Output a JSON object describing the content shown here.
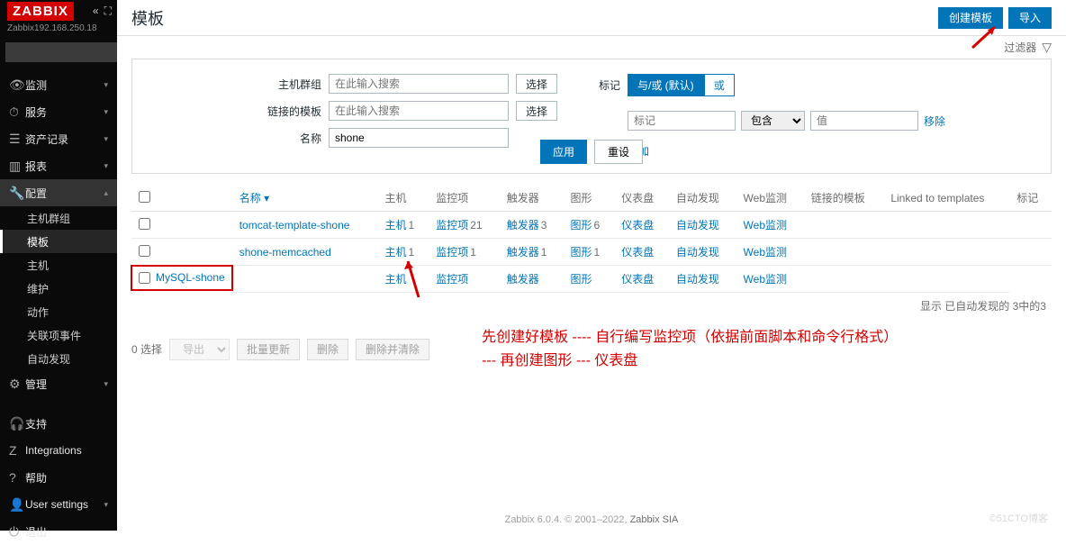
{
  "brand": "ZABBIX",
  "server": "Zabbix192.168.250.18",
  "nav": {
    "monitor": "监测",
    "service": "服务",
    "asset": "资产记录",
    "report": "报表",
    "config": "配置",
    "admin": "管理",
    "support": "支持",
    "integrations": "Integrations",
    "help": "帮助",
    "usersettings": "User settings",
    "logout": "退出"
  },
  "config_sub": {
    "hostgroups": "主机群组",
    "templates": "模板",
    "hosts": "主机",
    "maintenance": "维护",
    "actions": "动作",
    "eventcorrelation": "关联项事件",
    "discovery": "自动发现"
  },
  "page": {
    "title": "模板",
    "create": "创建模板",
    "import": "导入",
    "filterlabel": "过滤器"
  },
  "filter": {
    "hostgroups_label": "主机群组",
    "hostgroups_ph": "在此输入搜索",
    "select_btn": "选择",
    "linked_label": "链接的模板",
    "linked_ph": "在此输入搜索",
    "name_label": "名称",
    "name_val": "shone",
    "tag_label": "标记",
    "and_or": "与/或 (默认)",
    "or": "或",
    "tag_ph": "标记",
    "contains": "包含",
    "value_ph": "值",
    "remove": "移除",
    "add": "添加",
    "apply": "应用",
    "reset": "重设"
  },
  "table": {
    "headers": {
      "name": "名称",
      "hosts": "主机",
      "items": "监控项",
      "triggers": "触发器",
      "graphs": "图形",
      "dashboards": "仪表盘",
      "discovery": "自动发现",
      "web": "Web监测",
      "linked": "链接的模板",
      "linkedto": "Linked to templates",
      "tags": "标记"
    },
    "rows": [
      {
        "name": "tomcat-template-shone",
        "hosts": "主机",
        "hosts_n": "1",
        "items": "监控项",
        "items_n": "21",
        "triggers": "触发器",
        "triggers_n": "3",
        "graphs": "图形",
        "graphs_n": "6",
        "dash": "仪表盘",
        "disc": "自动发现",
        "web": "Web监测"
      },
      {
        "name": "shone-memcached",
        "hosts": "主机",
        "hosts_n": "1",
        "items": "监控项",
        "items_n": "1",
        "triggers": "触发器",
        "triggers_n": "1",
        "graphs": "图形",
        "graphs_n": "1",
        "dash": "仪表盘",
        "disc": "自动发现",
        "web": "Web监测"
      },
      {
        "name": "MySQL-shone",
        "hosts": "主机",
        "hosts_n": "",
        "items": "监控项",
        "items_n": "",
        "triggers": "触发器",
        "triggers_n": "",
        "graphs": "图形",
        "graphs_n": "",
        "dash": "仪表盘",
        "disc": "自动发现",
        "web": "Web监测"
      }
    ],
    "footer": "显示 已自动发现的 3中的3"
  },
  "bulk": {
    "selected": "0 选择",
    "export": "导出",
    "massupdate": "批量更新",
    "delete": "删除",
    "deleteclear": "删除并清除"
  },
  "annotation": {
    "line1": "先创建好模板 ---- 自行编写监控项（依据前面脚本和命令行格式）",
    "line2": "--- 再创建图形 --- 仪表盘"
  },
  "footer": {
    "text1": "Zabbix 6.0.4. © 2001–2022, ",
    "link": "Zabbix SIA",
    "watermark": "©51CTO博客"
  }
}
